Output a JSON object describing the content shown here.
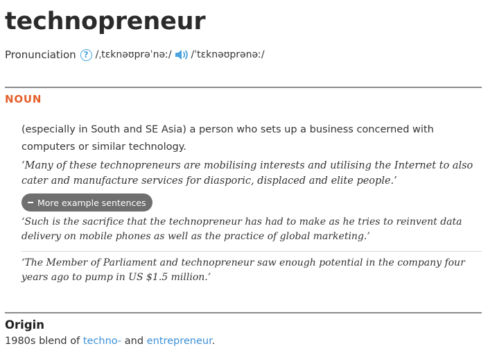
{
  "entry": {
    "headword": "technopreneur",
    "pronunciation_label": "Pronunciation",
    "help_icon": "question-circle-icon",
    "ipa_primary": "/ˌtɛknəʊprəˈnəː/",
    "audio_icon": "speaker-icon",
    "ipa_secondary": "/ˈtɛknəʊprənəː/"
  },
  "sense": {
    "part_of_speech": "NOUN",
    "definition": "(especially in South and SE Asia) a person who sets up a business concerned with computers or similar technology.",
    "example": "‘Many of these technopreneurs are mobilising interests and utilising the Internet to also cater and manufacture services for diasporic, displaced and elite people.’",
    "more_examples_label": "More example sentences",
    "more_examples": [
      "‘Such is the sacrifice that the technopreneur has had to make as he tries to reinvent data delivery on mobile phones as well as the practice of global marketing.’",
      "‘The Member of Parliament and technopreneur saw enough potential in the company four years ago to pump in US $1.5 million.’"
    ]
  },
  "origin": {
    "title": "Origin",
    "prefix": "1980s blend of ",
    "link1": "techno-",
    "middle": " and ",
    "link2": "entrepreneur",
    "suffix": "."
  },
  "colors": {
    "accent_orange": "#e4602b",
    "link_blue": "#3b8fd6",
    "icon_blue": "#4aa3df",
    "button_gray": "#6f6f6f"
  }
}
